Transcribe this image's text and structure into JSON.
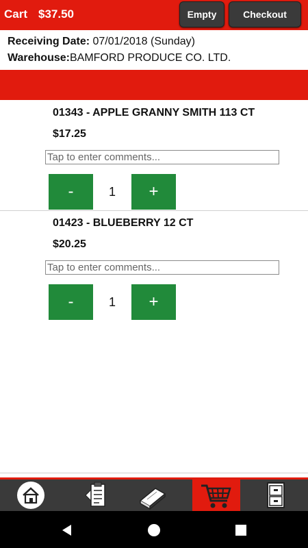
{
  "header": {
    "title": "Cart",
    "total": "$37.50",
    "empty_label": "Empty",
    "checkout_label": "Checkout"
  },
  "info": {
    "receiving_label": "Receiving Date:",
    "receiving_value": "07/01/2018 (Sunday)",
    "warehouse_label": "Warehouse:",
    "warehouse_value": "BAMFORD PRODUCE CO. LTD."
  },
  "items": [
    {
      "name": "01343 - APPLE GRANNY SMITH 113 CT",
      "price": "$17.25",
      "comment_placeholder": "Tap to enter comments...",
      "quantity": "1",
      "minus_label": "-",
      "plus_label": "+"
    },
    {
      "name": "01423 - BLUEBERRY 12 CT",
      "price": "$20.25",
      "comment_placeholder": "Tap to enter comments...",
      "quantity": "1",
      "minus_label": "-",
      "plus_label": "+"
    }
  ],
  "bottom_nav": {
    "items": [
      {
        "icon": "home-icon"
      },
      {
        "icon": "order-guide-icon"
      },
      {
        "icon": "catalog-book-icon"
      },
      {
        "icon": "cart-icon",
        "active": true
      },
      {
        "icon": "file-cabinet-icon"
      }
    ]
  },
  "colors": {
    "brand_red": "#e11b0e",
    "qty_green": "#218a3a",
    "dark_button": "#3a3a3a"
  }
}
